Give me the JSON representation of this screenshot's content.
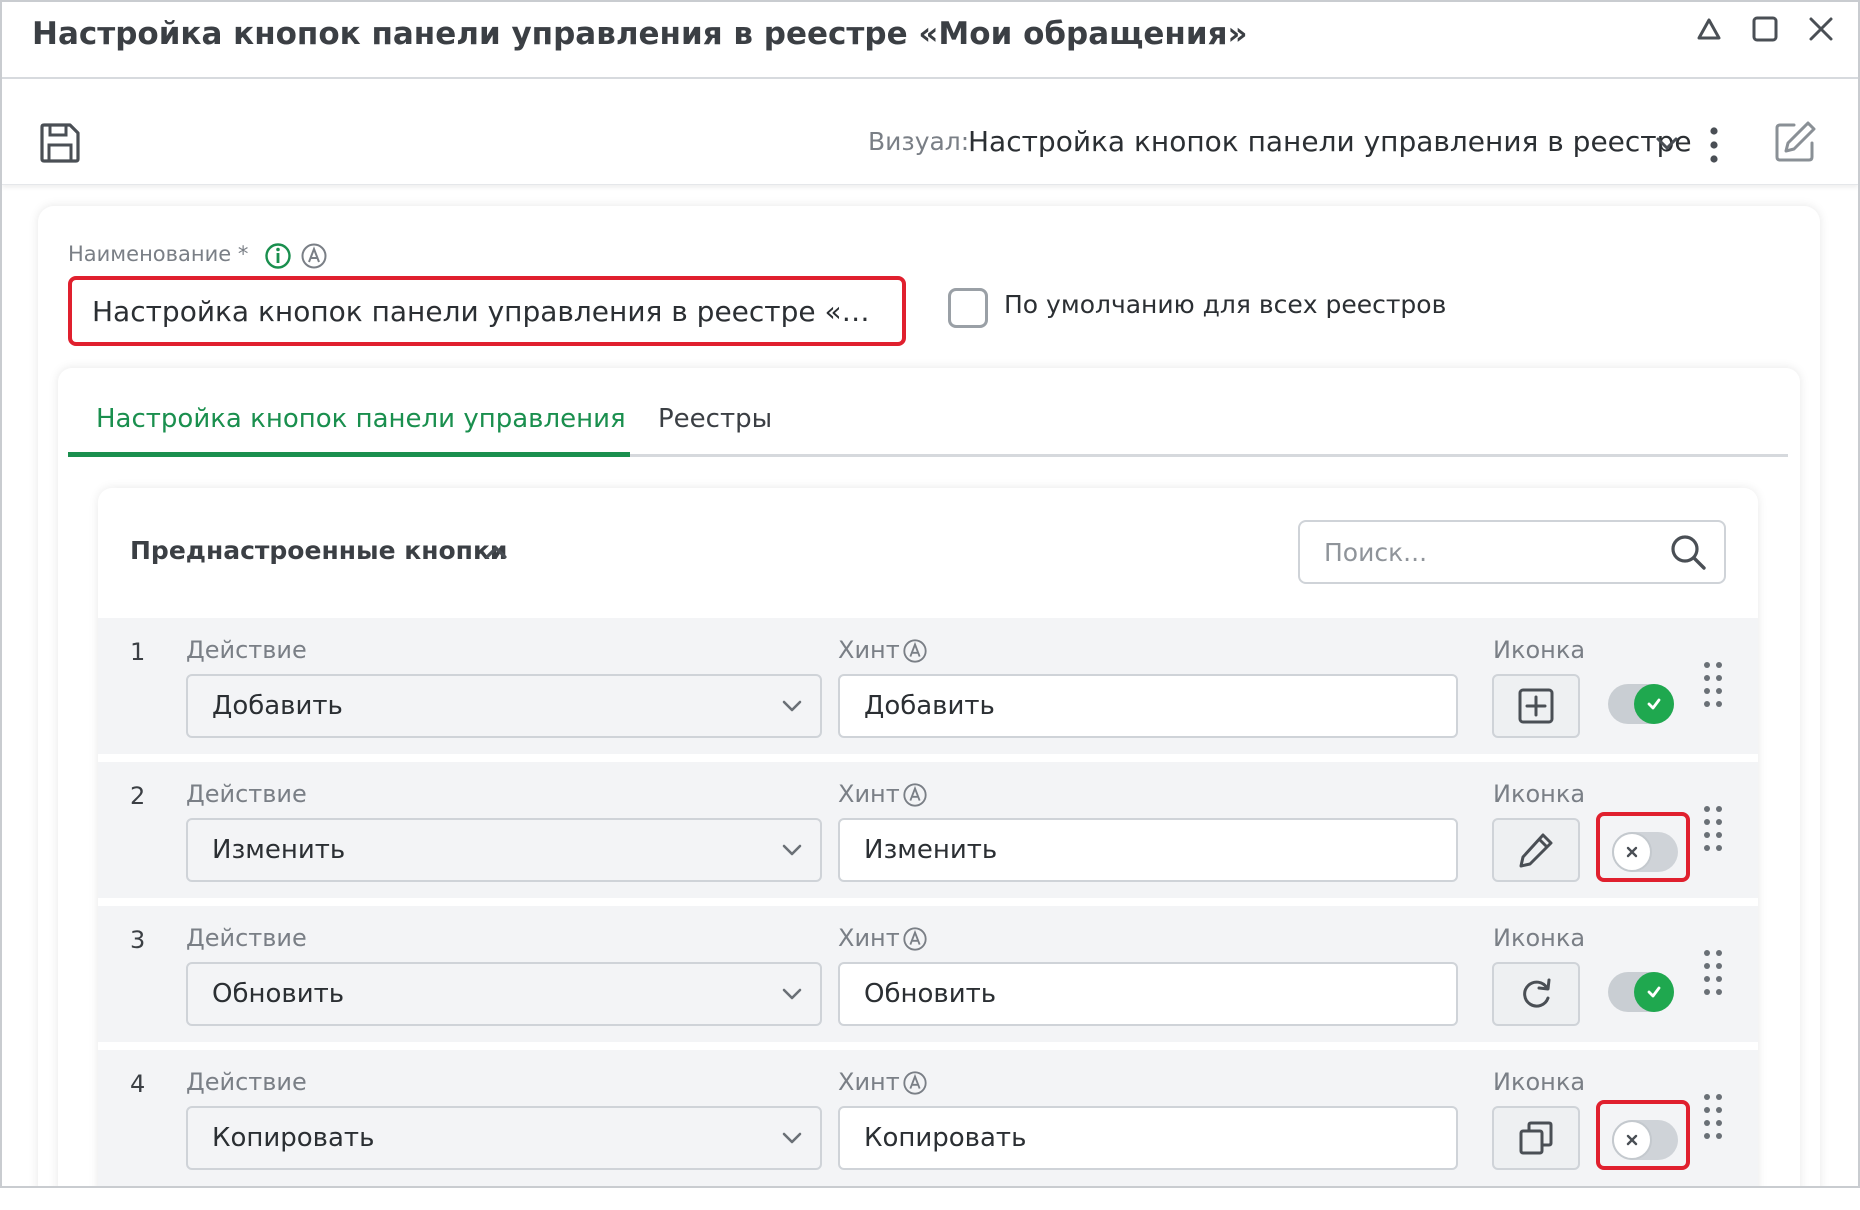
{
  "window": {
    "title": "Настройка кнопок панели управления в реестре «Мои обращения»"
  },
  "toolbar": {
    "visual_label": "Визуал:",
    "visual_value": "Настройка кнопок панели управления в реестре"
  },
  "form": {
    "name_label": "Наименование *",
    "name_value": "Настройка кнопок панели управления в реестре «Мои обращения»",
    "default_label": "По умолчанию для всех реестров",
    "default_checked": false
  },
  "tabs": [
    {
      "label": "Настройка кнопок панели управления",
      "active": true
    },
    {
      "label": "Реестры",
      "active": false
    }
  ],
  "section": {
    "title": "Преднастроенные кнопки",
    "search_placeholder": "Поиск..."
  },
  "labels": {
    "action": "Действие",
    "hint": "Хинт",
    "icon": "Иконка"
  },
  "rows": [
    {
      "num": "1",
      "action": "Добавить",
      "hint": "Добавить",
      "icon": "plus-square-icon",
      "enabled": true
    },
    {
      "num": "2",
      "action": "Изменить",
      "hint": "Изменить",
      "icon": "pencil-icon",
      "enabled": false
    },
    {
      "num": "3",
      "action": "Обновить",
      "hint": "Обновить",
      "icon": "refresh-icon",
      "enabled": true
    },
    {
      "num": "4",
      "action": "Копировать",
      "hint": "Копировать",
      "icon": "copy-icon",
      "enabled": false
    }
  ],
  "colors": {
    "accent": "#1a8f4e",
    "highlight": "#e0202e",
    "toggle_on": "#1fa84f"
  }
}
